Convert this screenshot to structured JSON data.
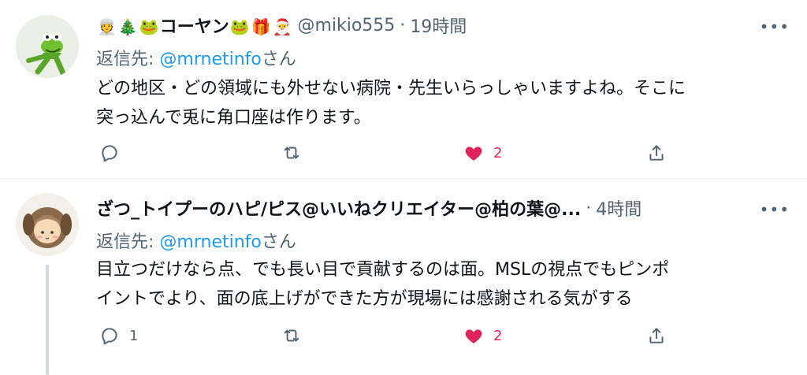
{
  "tweets": [
    {
      "author_name": "コーヤン",
      "name_emojis_before": [
        "👳",
        "🎄",
        "🐸"
      ],
      "name_emojis_after": [
        "🐸",
        "🎁",
        "🎅"
      ],
      "handle": "@mikio555",
      "separator": "·",
      "time": "19時間",
      "reply_prefix": "返信先: ",
      "reply_mention": "@mrnetinfo",
      "reply_suffix": "さん",
      "text_line1": "どの地区・どの領域にも外せない病院・先生いらっしゃいますよね。そこに",
      "text_line2": "突っ込んで兎に角口座は作ります。",
      "reply_count": "",
      "retweet_count": "",
      "like_count": "2",
      "avatar_icon": "kermit-frog-avatar"
    },
    {
      "author_name": "ざつ_トイプーのハピ/ピス@いいねクリエイター@柏の葉@...",
      "handle": "",
      "separator": "·",
      "time": "4時間",
      "reply_prefix": "返信先: ",
      "reply_mention": "@mrnetinfo",
      "reply_suffix": "さん",
      "text_line1": "目立つだけなら点、でも長い目で貢献するのは面。MSLの視点でもピンポ",
      "text_line2": "イントでより、面の底上げができた方が現場には感謝される気がする",
      "reply_count": "1",
      "retweet_count": "",
      "like_count": "2",
      "avatar_icon": "dog-costume-character-avatar"
    }
  ],
  "icons": {
    "more": "more-horizontal-icon",
    "reply": "reply-bubble-icon",
    "retweet": "retweet-icon",
    "like": "heart-filled-icon",
    "share": "share-upload-icon"
  },
  "colors": {
    "link": "#1d9bf0",
    "secondary_text": "#536471",
    "like": "#e0245e",
    "divider": "#e6ecf0"
  }
}
